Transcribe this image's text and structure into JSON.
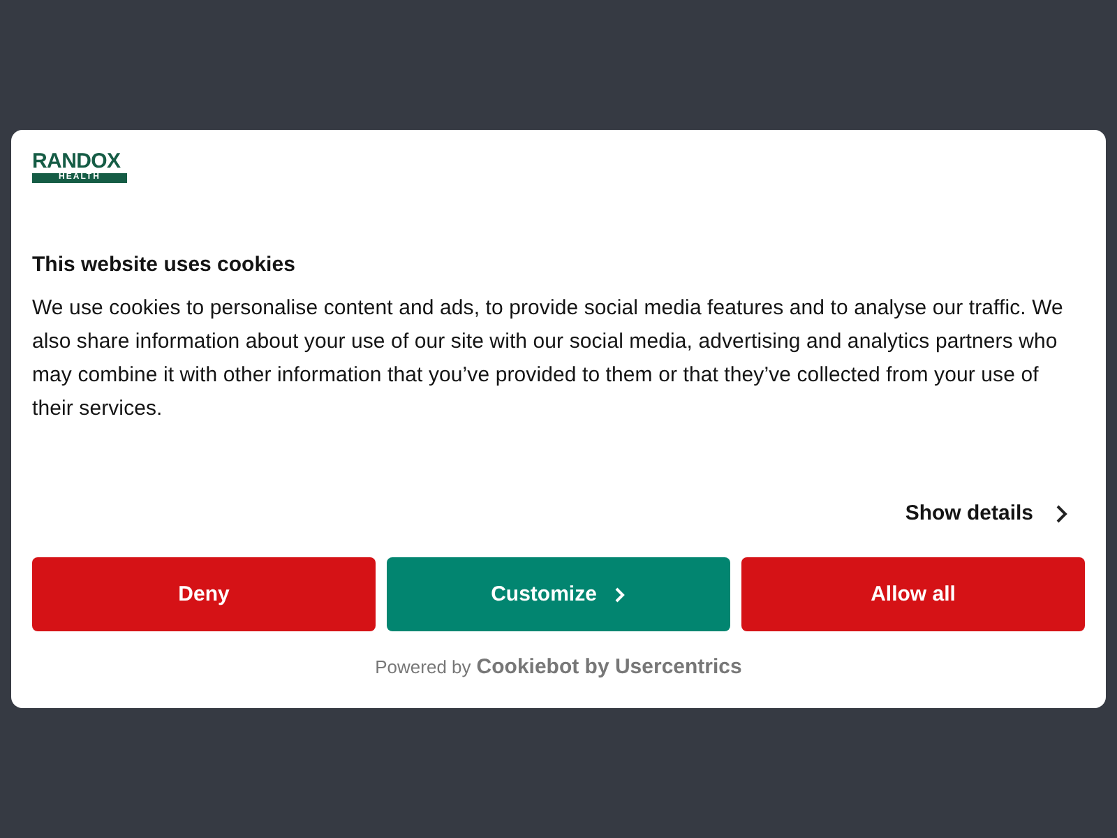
{
  "logo": {
    "name": "RANDOX",
    "sub": "HEALTH"
  },
  "dialog": {
    "title": "This website uses cookies",
    "body": "We use cookies to personalise content and ads, to provide social media features and to analyse our traffic. We also share information about your use of our site with our social media, advertising and analytics partners who may combine it with other information that you’ve provided to them or that they’ve collected from your use of their services.",
    "details_link": "Show details"
  },
  "buttons": [
    {
      "label": "Deny",
      "kind": "primary"
    },
    {
      "label": "Customize",
      "kind": "secondary"
    },
    {
      "label": "Allow all",
      "kind": "primary"
    }
  ],
  "footer": {
    "prefix": "Powered by",
    "brand": "Cookiebot by Usercentrics"
  }
}
